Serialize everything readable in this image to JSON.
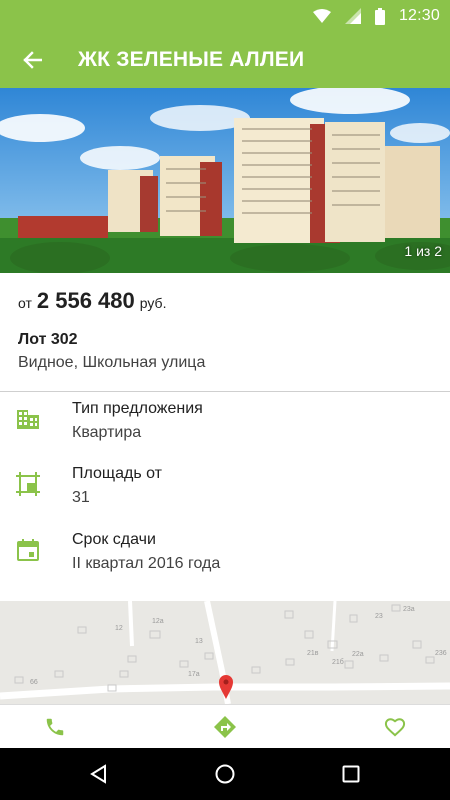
{
  "status_bar": {
    "time": "12:30",
    "icons": [
      "wifi-icon",
      "signal-icon",
      "battery-icon"
    ]
  },
  "app_bar": {
    "back_icon": "arrow-back-icon",
    "title": "ЖК ЗЕЛЕНЫЕ АЛЛЕИ"
  },
  "gallery": {
    "counter": "1 из 2"
  },
  "offer": {
    "price_prefix": "от",
    "price": "2 556 480",
    "currency": "руб.",
    "lot": "Лот 302",
    "address": "Видное, Школьная улица"
  },
  "properties": [
    {
      "icon": "building-icon",
      "label": "Тип предложения",
      "value": "Квартира"
    },
    {
      "icon": "area-icon",
      "label": "Площадь от",
      "value": "31"
    },
    {
      "icon": "calendar-icon",
      "label": "Срок сдачи",
      "value": "II квартал 2016 года"
    }
  ],
  "map": {
    "labels": [
      "12",
      "12a",
      "13",
      "17a",
      "66",
      "21в",
      "21б",
      "22a",
      "23",
      "23a",
      "236"
    ],
    "pin_icon": "map-pin-icon"
  },
  "actions": {
    "call_icon": "phone-icon",
    "route_icon": "directions-icon",
    "favorite_icon": "heart-icon"
  },
  "colors": {
    "accent": "#8bc34a",
    "pin": "#e53935"
  },
  "nav": [
    "back-icon",
    "home-icon",
    "recents-icon"
  ]
}
